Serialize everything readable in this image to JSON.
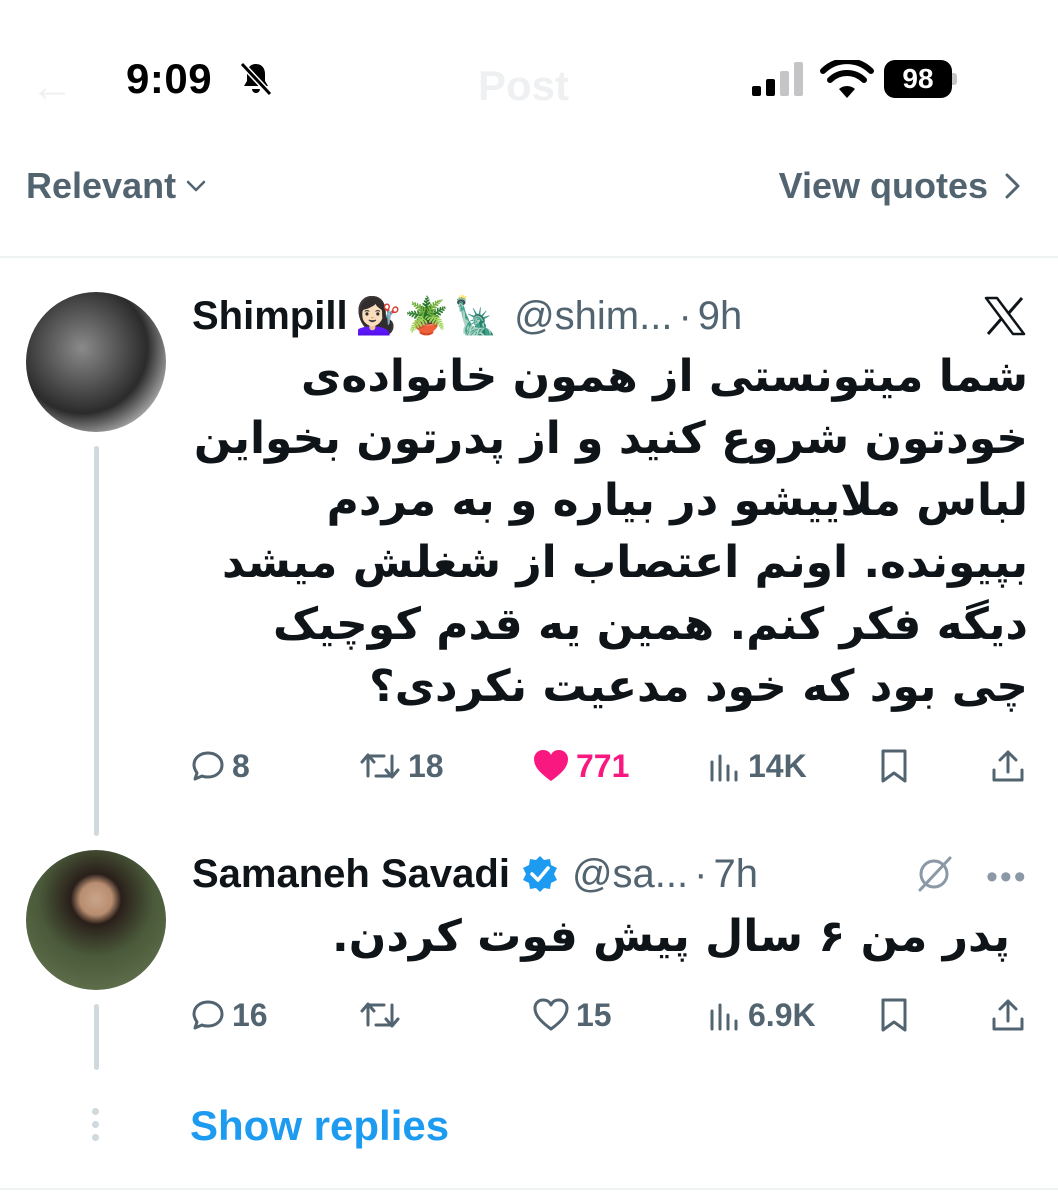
{
  "status_bar": {
    "time": "9:09",
    "battery": "98",
    "nav_title_ghost": "Post"
  },
  "filter_bar": {
    "sort_label": "Relevant",
    "view_quotes_label": "View quotes"
  },
  "tweets": [
    {
      "name": "Shimpill",
      "emojis": "💇🏻‍♀️🪴🗽",
      "handle": "@shim...",
      "separator": "·",
      "time": "9h",
      "text": "شما میتونستی از همون خانواده‌ی خودتون شروع کنید و از پدرتون بخواین لباس ملاییشو در بیاره و به مردم بپیونده. اونم اعتصاب از شغلش میشد دیگه فکر کنم. همین یه قدم کوچیک چی بود که خود مدعیت نکردی؟",
      "replies": "8",
      "reposts": "18",
      "likes": "771",
      "views": "14K",
      "liked": true
    },
    {
      "name": "Samaneh Savadi",
      "handle": "@sa...",
      "separator": "·",
      "time": "7h",
      "text": "پدر من ۶ سال پیش فوت کردن.",
      "replies": "16",
      "reposts": "",
      "likes": "15",
      "views": "6.9K",
      "verified": true
    }
  ],
  "show_replies_label": "Show replies",
  "colors": {
    "accent_blue": "#1d9bf0",
    "like_pink": "#f91880",
    "secondary_text": "#536471"
  }
}
